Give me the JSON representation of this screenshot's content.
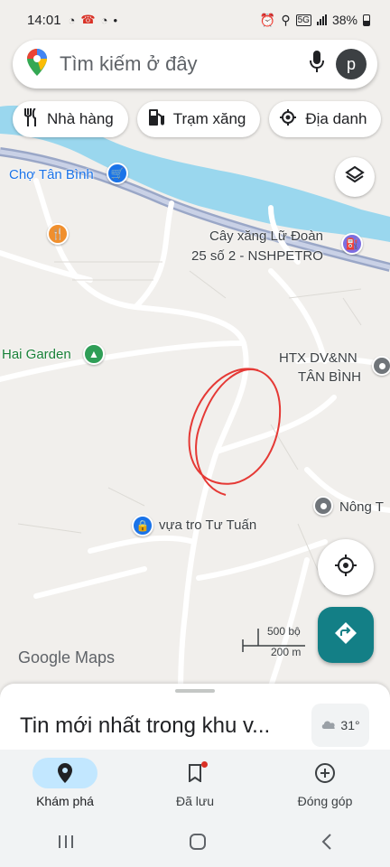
{
  "status_bar": {
    "time": "14:01",
    "network": "5G",
    "battery": "38%"
  },
  "search": {
    "placeholder": "Tìm kiếm ở đây",
    "avatar_letter": "p"
  },
  "chips": [
    {
      "label": "Nhà hàng",
      "icon": "restaurant-icon"
    },
    {
      "label": "Trạm xăng",
      "icon": "gas-station-icon"
    },
    {
      "label": "Địa danh",
      "icon": "landmark-icon"
    }
  ],
  "map": {
    "places": {
      "cho_tan_binh": "Chợ Tân Bình",
      "cay_xang_line1": "Cây xăng Lữ Đoàn",
      "cay_xang_line2": "25 số 2 - NSHPETRO",
      "hai_garden": "Hai Garden",
      "htx_line1": "HTX DV&NN",
      "htx_line2": "TÂN BÌNH",
      "nong_t": "Nông T",
      "vua_tro": "vựa tro Tư Tuấn"
    },
    "scale": {
      "imperial": "500 bộ",
      "metric": "200 m"
    },
    "logo": "Google Maps",
    "colors": {
      "water": "#9ad7ee",
      "highway": "#9aa7c7",
      "annotation": "#e53935"
    }
  },
  "sheet": {
    "title": "Tin mới nhất trong khu v...",
    "weather": "31°"
  },
  "bottom_nav": [
    {
      "label": "Khám phá",
      "icon": "explore-pin-icon",
      "active": true
    },
    {
      "label": "Đã lưu",
      "icon": "bookmark-icon",
      "active": false
    },
    {
      "label": "Đóng góp",
      "icon": "add-circle-icon",
      "active": false
    }
  ]
}
